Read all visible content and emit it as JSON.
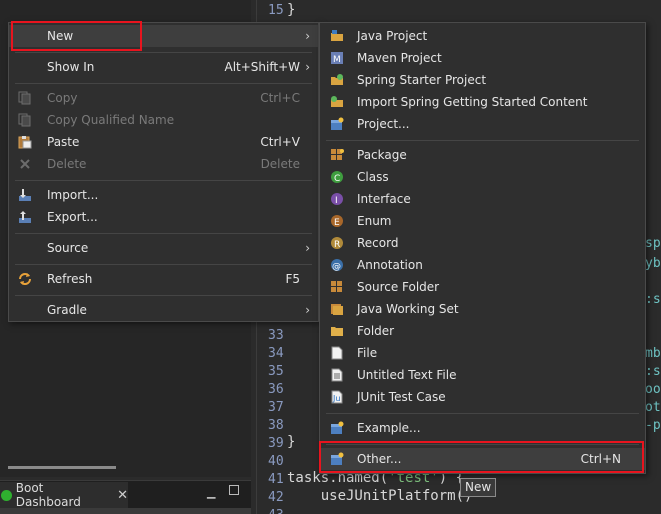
{
  "editor": {
    "line_numbers": {
      "l15": "15",
      "l33": "33",
      "l34": "34",
      "l35": "35",
      "l36": "36",
      "l37": "37",
      "l38": "38",
      "l39": "39",
      "l40": "40",
      "l41": "41",
      "l42": "42",
      "l43": "43"
    },
    "code": {
      "l15": "}",
      "l39": "}",
      "l41_a": "tasks.named(",
      "l41_str": "'test'",
      "l41_b": ") {",
      "l42": "    useJUnitPlatform()"
    },
    "right_fragments": {
      "f1": "sp",
      "f2": "yb",
      "f3": ":s",
      "f4": "mb",
      "f5": ":s",
      "f6": "oo",
      "f7": "ot",
      "f8": "-p"
    }
  },
  "boot_dashboard": {
    "tab_label": "Boot Dashboard",
    "close_glyph": "✕",
    "minimize_glyph": "▁"
  },
  "context_menu": {
    "new": {
      "label": "New",
      "arrow": "›"
    },
    "show_in": {
      "label": "Show In",
      "accel": "Alt+Shift+W",
      "arrow": "›"
    },
    "copy": {
      "label": "Copy",
      "accel": "Ctrl+C"
    },
    "copy_qualified": {
      "label": "Copy Qualified Name"
    },
    "paste": {
      "label": "Paste",
      "accel": "Ctrl+V"
    },
    "delete": {
      "label": "Delete",
      "accel": "Delete"
    },
    "import": {
      "label": "Import..."
    },
    "export": {
      "label": "Export..."
    },
    "source": {
      "label": "Source",
      "arrow": "›"
    },
    "refresh": {
      "label": "Refresh",
      "accel": "F5"
    },
    "gradle": {
      "label": "Gradle",
      "arrow": "›"
    }
  },
  "new_menu": {
    "java_project": "Java Project",
    "maven_project": "Maven Project",
    "spring_starter": "Spring Starter Project",
    "import_spring": "Import Spring Getting Started Content",
    "project": "Project...",
    "package": "Package",
    "class": "Class",
    "interface": "Interface",
    "enum": "Enum",
    "record": "Record",
    "annotation": "Annotation",
    "source_folder": "Source Folder",
    "java_working_set": "Java Working Set",
    "folder": "Folder",
    "file": "File",
    "untitled_text": "Untitled Text File",
    "junit_test": "JUnit Test Case",
    "example": "Example...",
    "other": "Other...",
    "other_accel": "Ctrl+N"
  },
  "tooltip": "New",
  "colors": {
    "highlight_box": "#e8141e",
    "menu_bg": "#2f2f2f",
    "editor_bg": "#2b2b2b"
  }
}
